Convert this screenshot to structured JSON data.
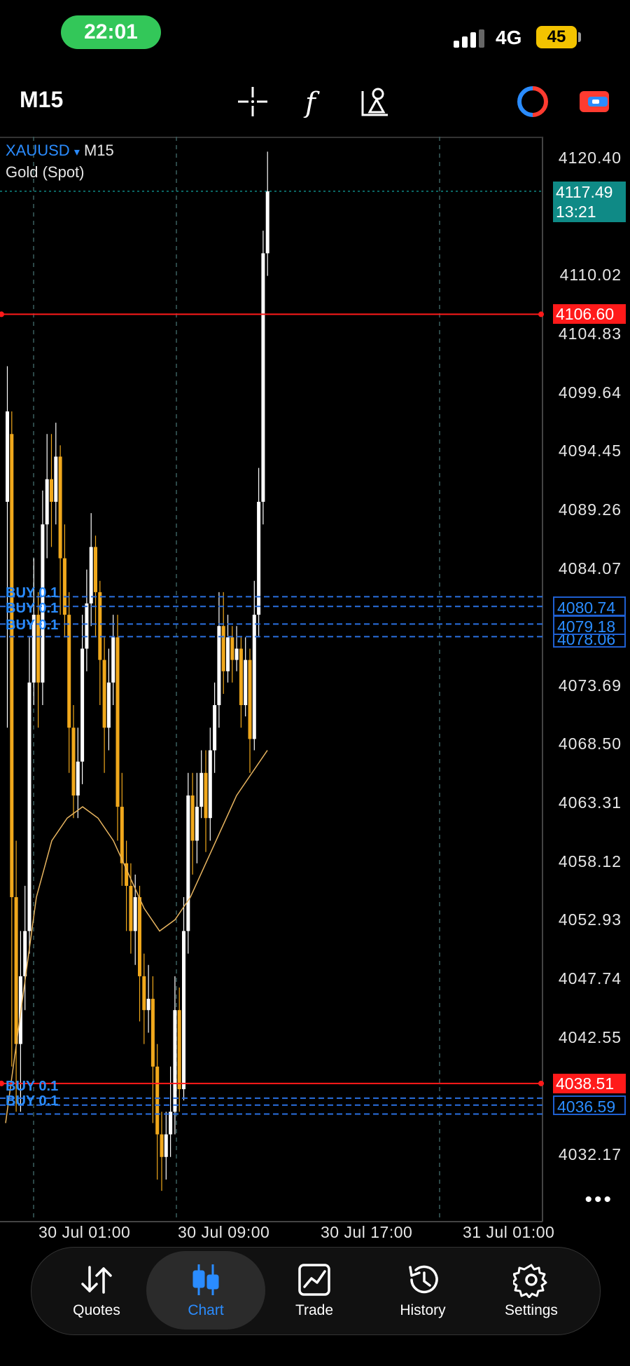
{
  "status_bar": {
    "time": "22:01",
    "network": "4G",
    "battery": "45"
  },
  "toolbar": {
    "timeframe": "M15",
    "icons": [
      "crosshair-icon",
      "indicator-f-icon",
      "objects-icon",
      "one-click-trading-icon",
      "account-icon"
    ]
  },
  "chart": {
    "symbol": "XAUUSD",
    "symbol_arrow": "▾",
    "timeframe": "M15",
    "description": "Gold (Spot)",
    "price_axis": [
      "4120.40",
      "4110.02",
      "4104.83",
      "4099.64",
      "4094.45",
      "4089.26",
      "4084.07",
      "4073.69",
      "4068.50",
      "4063.31",
      "4058.12",
      "4052.93",
      "4047.74",
      "4042.55",
      "4032.17"
    ],
    "time_axis": [
      "30 Jul 01:00",
      "30 Jul 09:00",
      "30 Jul 17:00",
      "31 Jul 01:00"
    ],
    "current_price": {
      "price": "4117.49",
      "countdown": "13:21"
    },
    "levels_red": [
      "4106.60",
      "4038.51"
    ],
    "levels_blue": [
      "4080.74",
      "4079.18",
      "4078.06",
      "4036.59"
    ],
    "buy_labels": [
      "BUY 0.1",
      "BUY 0.1",
      "BUY 0.1",
      "BUY 0.1",
      "BUY 0.1"
    ],
    "more": "•••"
  },
  "nav": {
    "items": [
      {
        "label": "Quotes",
        "icon": "quotes-arrows-icon"
      },
      {
        "label": "Chart",
        "icon": "candlestick-icon"
      },
      {
        "label": "Trade",
        "icon": "trade-chart-icon"
      },
      {
        "label": "History",
        "icon": "history-clock-icon"
      },
      {
        "label": "Settings",
        "icon": "gear-icon"
      }
    ],
    "active": "Chart",
    "active_color": "#2a8cff"
  },
  "colors": {
    "bull": "#ffffff",
    "bear": "#f0a81c",
    "ma": "#e8b560",
    "red_line": "#ff1a1a",
    "blue_line": "#2a6fe0",
    "current": "#0f8a86"
  }
}
